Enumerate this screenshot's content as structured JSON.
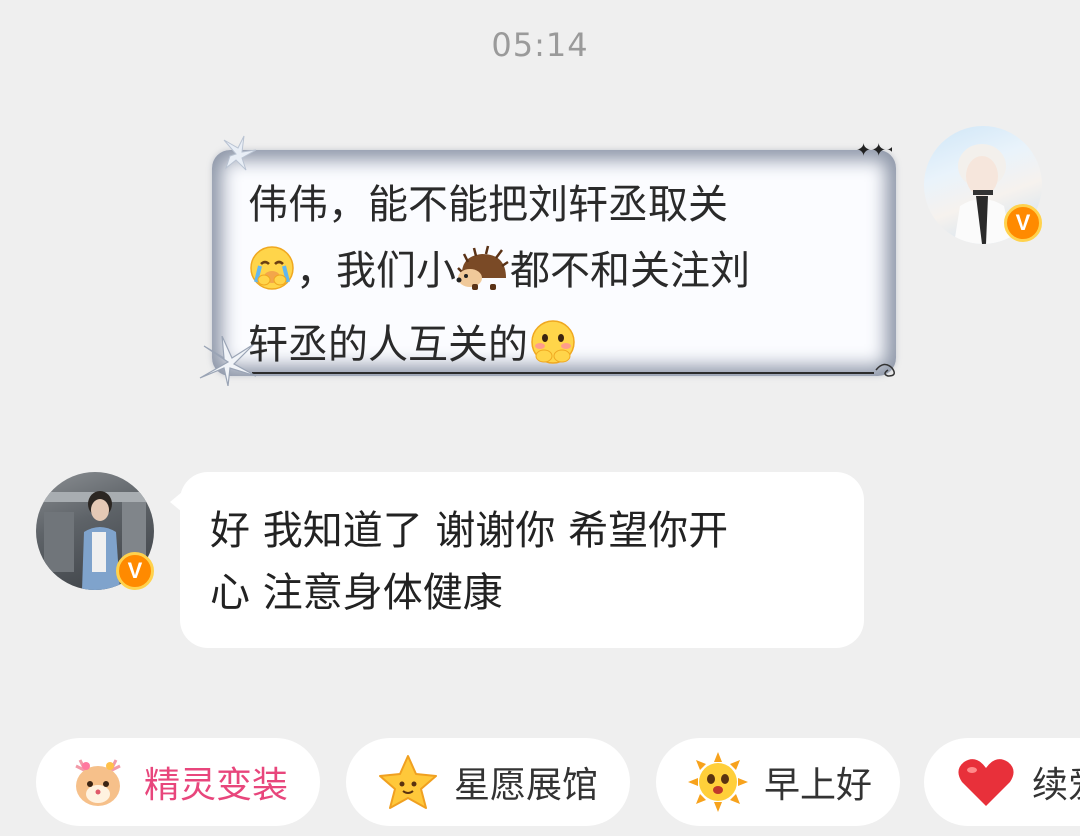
{
  "chat": {
    "timestamp": "05:14",
    "outgoing": {
      "line1": "伟伟，能不能把刘轩丞取关",
      "line2_a": "，我们小",
      "line2_b": "都不和关注刘",
      "line3": "轩丞的人互关的",
      "emojis": [
        "crying-face-emoji",
        "hedgehog-emoji",
        "shy-face-emoji"
      ],
      "badge": "V"
    },
    "incoming": {
      "line1": "好 我知道了 谢谢你 希望你开",
      "line2": "心 注意身体健康",
      "badge": "V"
    }
  },
  "quick_replies": [
    {
      "label": "精灵变装",
      "icon": "deer-spirit-icon",
      "color": "#e8467c"
    },
    {
      "label": "星愿展馆",
      "icon": "star-icon"
    },
    {
      "label": "早上好",
      "icon": "sun-icon"
    },
    {
      "label": "续爱",
      "icon": "heart-icon"
    }
  ]
}
